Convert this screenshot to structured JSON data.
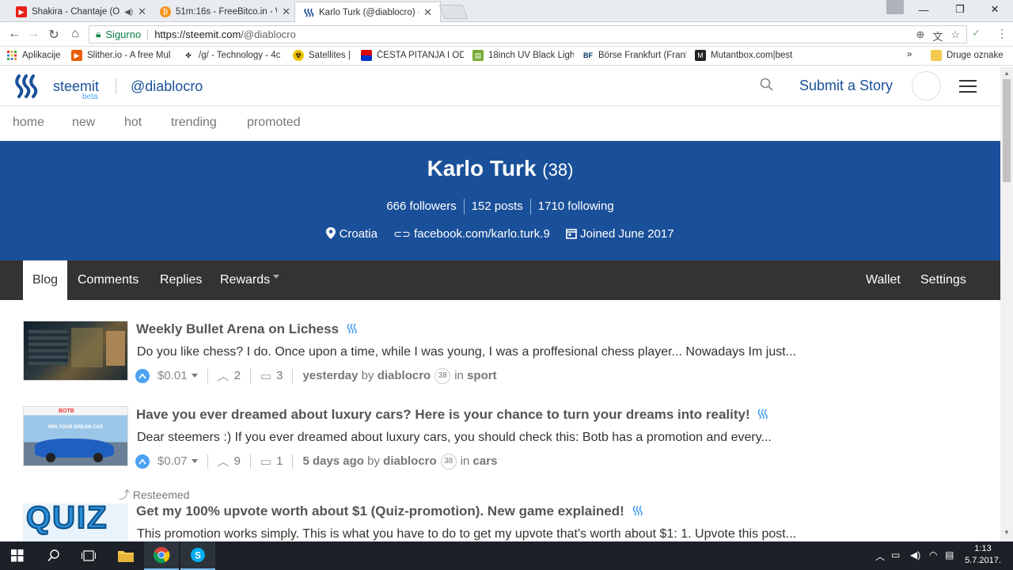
{
  "browser": {
    "tabs": [
      {
        "title": "Shakira - Chantaje (Of",
        "icon": "youtube-icon",
        "color": "#e62117"
      },
      {
        "title": "51m:16s - FreeBitco.in - W",
        "icon": "bitcoin-icon",
        "color": "#f7931a"
      },
      {
        "title": "Karlo Turk (@diablocro) -",
        "icon": "steemit-icon",
        "color": "#1a5099"
      }
    ],
    "security_label": "Sigurno",
    "url_host": "https://steemit.com",
    "url_path": "/@diablocro",
    "bookmarks": [
      {
        "label": "Aplikacije",
        "icon": "apps-grid-icon"
      },
      {
        "label": "Slither.io - A free Mul",
        "icon": "slither-icon"
      },
      {
        "label": "/g/ - Technology - 4c",
        "icon": "clover-icon"
      },
      {
        "label": "Satellites |",
        "icon": "radiation-icon"
      },
      {
        "label": "ČESTA PITANJA I ODG",
        "icon": "flag-icon"
      },
      {
        "label": "18inch UV Black Light",
        "icon": "shop-icon"
      },
      {
        "label": "Börse Frankfurt (Frank",
        "icon": "bf-icon"
      },
      {
        "label": "Mutantbox.com|best",
        "icon": "m-icon"
      }
    ],
    "bookmarks_more": "»",
    "other_bookmarks": "Druge oznake"
  },
  "site": {
    "brand": "steemit",
    "beta": "beta",
    "handle": "@diablocro",
    "submit": "Submit a Story",
    "nav": [
      "home",
      "new",
      "hot",
      "trending",
      "promoted"
    ]
  },
  "profile": {
    "name": "Karlo Turk",
    "reputation": "(38)",
    "followers": "666 followers",
    "posts": "152 posts",
    "following": "1710 following",
    "location": "Croatia",
    "website": "facebook.com/karlo.turk.9",
    "joined": "Joined June 2017",
    "tabs": [
      "Blog",
      "Comments",
      "Replies",
      "Rewards"
    ],
    "right_tabs": [
      "Wallet",
      "Settings"
    ]
  },
  "posts": [
    {
      "title": "Weekly Bullet Arena on Lichess",
      "desc": "Do you like chess? I do. Once upon a time, while I was young, I was a proffesional chess player... Nowadays Im just...",
      "payout": "$0.01",
      "votes": "2",
      "comments": "3",
      "time": "yesterday",
      "by": "by",
      "author": "diablocro",
      "rep": "38",
      "in": "in",
      "category": "sport"
    },
    {
      "title": "Have you ever dreamed about luxury cars? Here is your chance to turn your dreams into reality!",
      "desc": "Dear steemers :) If you ever dreamed about luxury cars, you should check this: Botb has a promotion and every...",
      "payout": "$0.07",
      "votes": "9",
      "comments": "1",
      "time": "5 days ago",
      "by": "by",
      "author": "diablocro",
      "rep": "38",
      "in": "in",
      "category": "cars",
      "thumb_label": "WIN YOUR DREAM CAR"
    },
    {
      "resteemed": "Resteemed",
      "title": "Get my 100% upvote worth about $1 (Quiz-promotion). New game explained!",
      "desc": "This promotion works simply. This is what you have to do to get my upvote that's worth about $1: 1. Upvote this post...",
      "thumb_label": "QUIZ"
    }
  ],
  "taskbar": {
    "time": "1:13",
    "date": "5.7.2017."
  },
  "colors": {
    "steemit_blue": "#1a5099",
    "upvote_blue": "#4ba2f2",
    "tabbar_dark": "#333333"
  }
}
